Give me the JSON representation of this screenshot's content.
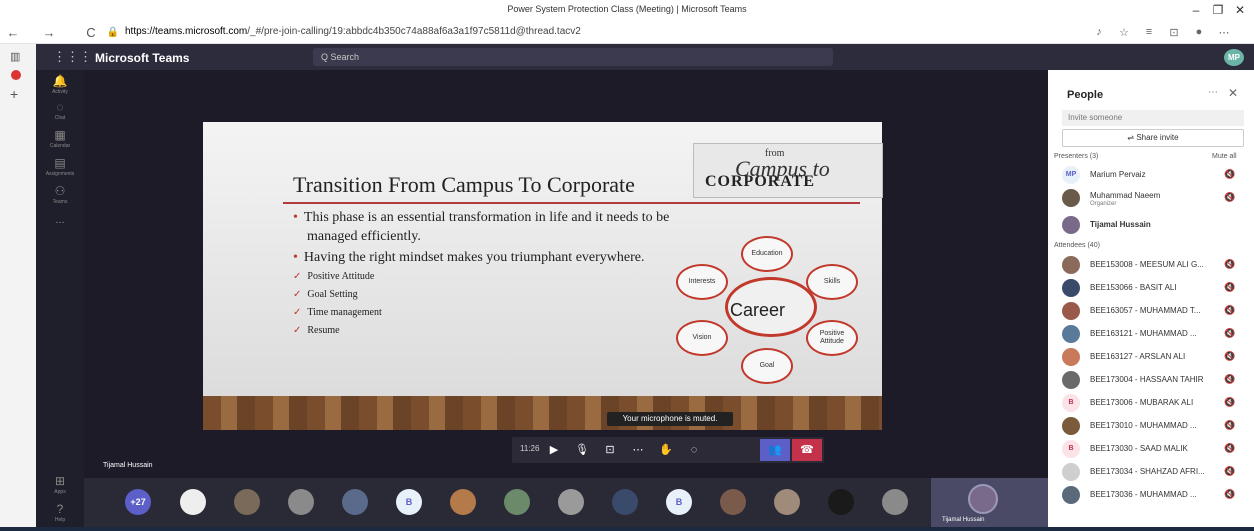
{
  "browser": {
    "tab_title": "Power System Protection Class (Meeting) | Microsoft Teams",
    "url_host": "https://teams.microsoft.com",
    "url_path": "/_#/pre-join-calling/19:abbdc4b350c74a88af6a3a1f97c5811d@thread.tacv2"
  },
  "teams": {
    "app_name": "Microsoft Teams",
    "search_placeholder": "Q  Search",
    "me_initials": "MP",
    "rail": [
      "Activity",
      "Chat",
      "Calendar",
      "Assignments",
      "Teams",
      "...",
      "Apps",
      "Help"
    ]
  },
  "slide": {
    "title": "Transition From Campus To Corporate",
    "logo_from": "from",
    "logo_campus": "Campus to",
    "logo_corporate": "CORPORATE",
    "bullets": [
      "This phase is an essential transformation in life and it needs to be",
      "managed efficiently.",
      "Having the right mindset makes you triumphant everywhere."
    ],
    "checks": [
      "Positive Attitude",
      "Goal Setting",
      "Time management",
      "Resume"
    ],
    "center": "Career",
    "nodes": [
      "Education",
      "Skills",
      "Positive Attitude",
      "Goal",
      "Vision",
      "Interests"
    ]
  },
  "meeting": {
    "toast": "Your microphone is muted.",
    "time": "11:26",
    "speaker": "Tijamal Hussain",
    "self_name": "Tijamal Hussain",
    "overflow_count": "+27",
    "letter_avatar": "B"
  },
  "people": {
    "title": "People",
    "invite_placeholder": "Invite someone",
    "share_label": "Share invite",
    "presenters_label": "Presenters (3)",
    "mute_all": "Mute all",
    "attendees_label": "Attendees (40)",
    "presenters": [
      {
        "initials": "MP",
        "name": "Marium Pervaiz",
        "sub": ""
      },
      {
        "initials": "",
        "name": "Muhammad Naeem",
        "sub": "Organizer"
      },
      {
        "initials": "",
        "name": "Tijamal Hussain",
        "sub": ""
      }
    ],
    "attendees": [
      {
        "initials": "",
        "name": "BEE153008 - MEESUM ALI G..."
      },
      {
        "initials": "",
        "name": "BEE153066 - BASIT ALI"
      },
      {
        "initials": "",
        "name": "BEE163057 - MUHAMMAD T..."
      },
      {
        "initials": "",
        "name": "BEE163121 - MUHAMMAD ..."
      },
      {
        "initials": "",
        "name": "BEE163127 - ARSLAN ALI"
      },
      {
        "initials": "",
        "name": "BEE173004 - HASSAAN TAHIR"
      },
      {
        "initials": "B",
        "name": "BEE173006 - MUBARAK ALI"
      },
      {
        "initials": "",
        "name": "BEE173010 - MUHAMMAD ..."
      },
      {
        "initials": "B",
        "name": "BEE173030 - SAAD MALIK"
      },
      {
        "initials": "",
        "name": "BEE173034 - SHAHZAD AFRI..."
      },
      {
        "initials": "",
        "name": "BEE173036 - MUHAMMAD ..."
      }
    ]
  },
  "colors": {
    "teams_purple": "#5b5fc7",
    "hangup_red": "#c4314b",
    "accent_red": "#c0392b"
  }
}
